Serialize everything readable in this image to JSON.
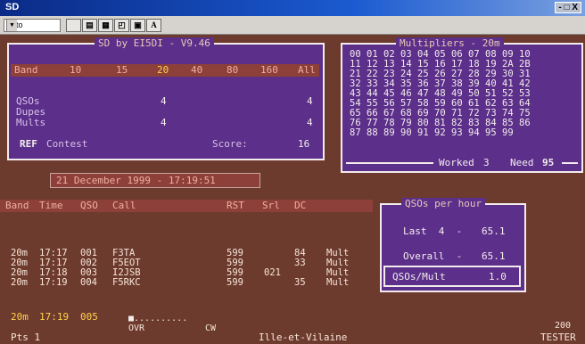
{
  "window": {
    "title": "SD",
    "controls": "- □ X"
  },
  "toolbar": {
    "font_select": "Auto",
    "font_button": "A"
  },
  "main_box": {
    "title": "SD by EI5DI - V9.46",
    "band_label": "Band",
    "bands": [
      "10",
      "15",
      "20",
      "40",
      "80",
      "160",
      "All"
    ],
    "active_band": "20",
    "rows": [
      {
        "label": "QSOs",
        "band20": "4",
        "all": "4"
      },
      {
        "label": "Dupes",
        "band20": "",
        "all": ""
      },
      {
        "label": "Mults",
        "band20": "4",
        "all": "4"
      }
    ],
    "ref_label": "REF",
    "contest_label": "Contest",
    "score_label": "Score:",
    "score_value": "16"
  },
  "multipliers": {
    "title": "Multipliers - 20m",
    "rows": [
      [
        "00",
        "01",
        "02",
        "03",
        "04",
        "05",
        "06",
        "07",
        "08",
        "09",
        "10"
      ],
      [
        "11",
        "12",
        "13",
        "14",
        "15",
        "16",
        "17",
        "18",
        "19",
        "2A",
        "2B"
      ],
      [
        "21",
        "22",
        "23",
        "24",
        "25",
        "26",
        "27",
        "28",
        "29",
        "30",
        "31"
      ],
      [
        "32",
        "33",
        "34",
        "35",
        "36",
        "37",
        "38",
        "39",
        "40",
        "41",
        "42"
      ],
      [
        "43",
        "44",
        "45",
        "46",
        "47",
        "48",
        "49",
        "50",
        "51",
        "52",
        "53"
      ],
      [
        "54",
        "55",
        "56",
        "57",
        "58",
        "59",
        "60",
        "61",
        "62",
        "63",
        "64"
      ],
      [
        "65",
        "66",
        "67",
        "68",
        "69",
        "70",
        "71",
        "72",
        "73",
        "74",
        "75"
      ],
      [
        "76",
        "77",
        "78",
        "79",
        "80",
        "81",
        "82",
        "83",
        "84",
        "85",
        "86"
      ],
      [
        "87",
        "88",
        "89",
        "90",
        "91",
        "92",
        "93",
        "94",
        "95",
        "99",
        ""
      ]
    ],
    "worked_label": "Worked",
    "worked_value": "3",
    "need_label": "Need",
    "need_value": "95"
  },
  "datetime": "21 December 1999 - 17:19:51",
  "log": {
    "headers": [
      "Band",
      "Time",
      "QSO",
      "Call",
      "RST",
      "Srl",
      "DC"
    ],
    "entries": [
      {
        "band": "20m",
        "time": "17:17",
        "qso": "001",
        "call": "F3TA",
        "rst": "599",
        "srl": "",
        "dc": "84",
        "note": "Mult"
      },
      {
        "band": "20m",
        "time": "17:17",
        "qso": "002",
        "call": "F5EOT",
        "rst": "599",
        "srl": "",
        "dc": "33",
        "note": "Mult"
      },
      {
        "band": "20m",
        "time": "17:18",
        "qso": "003",
        "call": "I2JSB",
        "rst": "599",
        "srl": "021",
        "dc": "",
        "note": "Mult"
      },
      {
        "band": "20m",
        "time": "17:19",
        "qso": "004",
        "call": "F5RKC",
        "rst": "599",
        "srl": "",
        "dc": "35",
        "note": "Mult"
      }
    ],
    "current": {
      "band": "20m",
      "time": "17:19",
      "qso": "005",
      "call_entry": "■.........."
    }
  },
  "qso_rate": {
    "title": "QSOs per hour",
    "last_label": "Last  4  -",
    "last_value": "65.1",
    "overall_label": "Overall  -",
    "overall_value": "65.1",
    "per_mult_label": "QSOs/Mult",
    "per_mult_value": "1.0"
  },
  "status": {
    "ovr": "OVR",
    "mode": "CW",
    "pts": "Pts 1",
    "region": "Ille-et-Vilaine",
    "number": "200",
    "tester": "TESTER"
  }
}
